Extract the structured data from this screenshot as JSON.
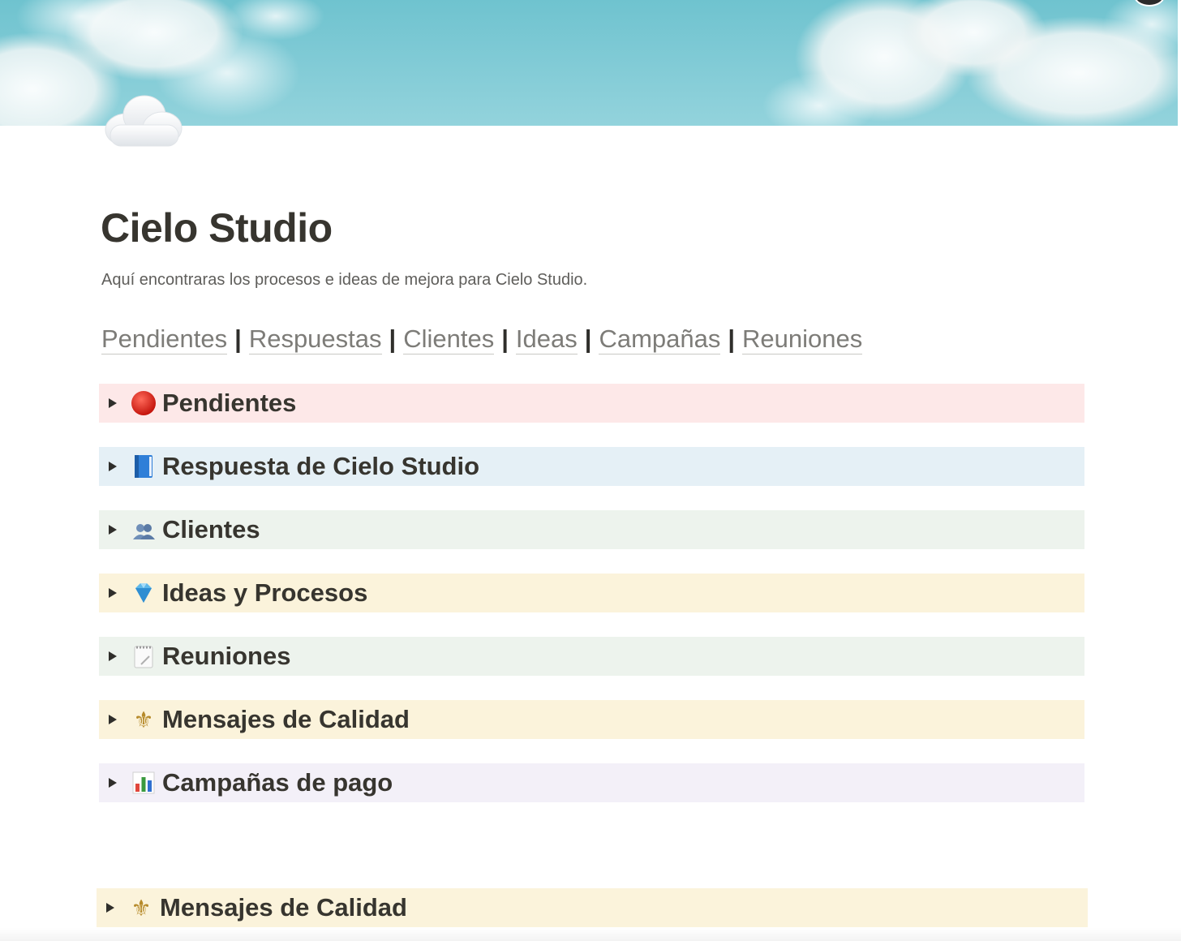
{
  "page": {
    "title": "Cielo Studio",
    "description": "Aquí encontraras los procesos e ideas de mejora para Cielo Studio.",
    "cover": "sky-clouds-cover",
    "icon": "cloud-icon"
  },
  "links": [
    {
      "label": "Pendientes"
    },
    {
      "label": "Respuestas"
    },
    {
      "label": "Clientes"
    },
    {
      "label": "Ideas"
    },
    {
      "label": "Campañas"
    },
    {
      "label": "Reuniones"
    }
  ],
  "separator": "|",
  "toggles": [
    {
      "label": "Pendientes",
      "icon": "red-circle-icon",
      "bg": "#fde8e8"
    },
    {
      "label": "Respuesta de Cielo Studio",
      "icon": "blue-book-icon",
      "bg": "#e5f0f6"
    },
    {
      "label": "Clientes",
      "icon": "people-icon",
      "bg": "#edf3ed"
    },
    {
      "label": "Ideas y Procesos",
      "icon": "gem-icon",
      "bg": "#fbf3db"
    },
    {
      "label": "Reuniones",
      "icon": "notepad-icon",
      "bg": "#edf3ed"
    },
    {
      "label": "Mensajes de Calidad",
      "icon": "fleur-de-lis-icon",
      "bg": "#fbf3db"
    },
    {
      "label": "Campañas de pago",
      "icon": "bar-chart-icon",
      "bg": "#f3f0f8"
    }
  ],
  "bottom_toggle": {
    "label": "Mensajes de Calidad",
    "icon": "fleur-de-lis-icon",
    "bg": "#fbf3db"
  }
}
